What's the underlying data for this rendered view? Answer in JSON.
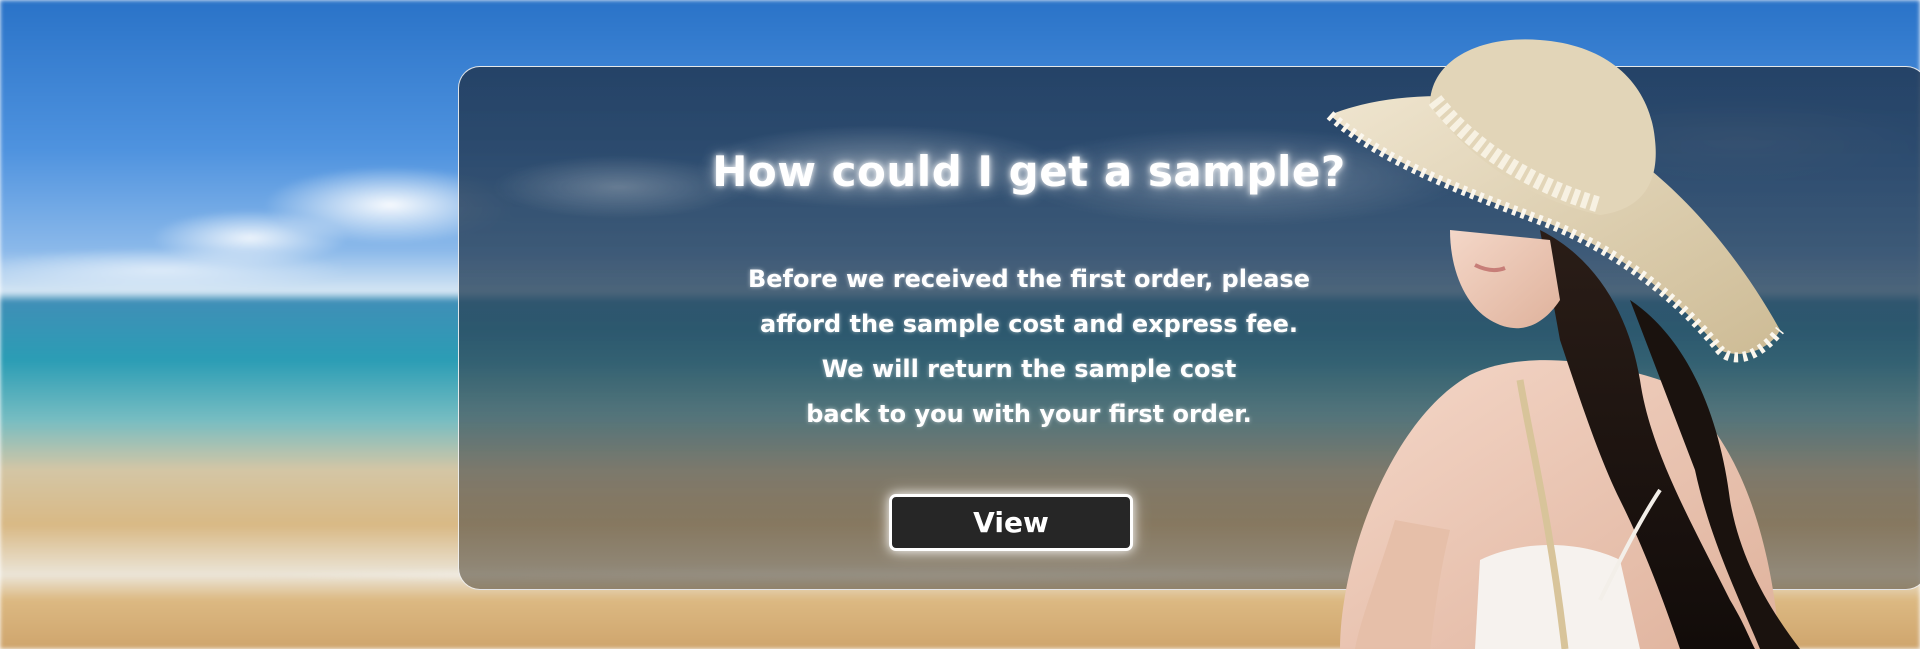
{
  "banner": {
    "title": "How could I get a sample?",
    "body_lines": [
      "Before we received the first order, please",
      "afford the sample cost and express fee.",
      "We will return the sample cost",
      "back to you with your first order."
    ],
    "button_label": "View"
  },
  "colors": {
    "button_background": "#262626",
    "button_border": "#ffffff",
    "text": "#ffffff",
    "sky": "#4f93df",
    "sea": "#2b9db5",
    "sand": "#d9b985"
  },
  "images": {
    "background": "beach-scene",
    "model": "woman-in-straw-sun-hat"
  }
}
